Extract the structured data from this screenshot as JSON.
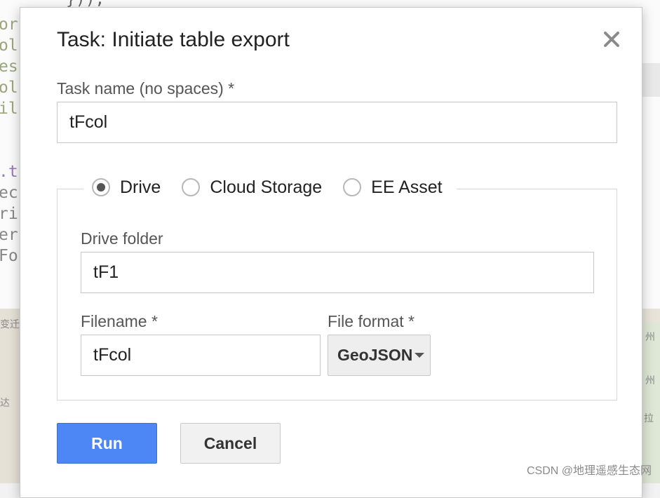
{
  "background": {
    "code_top": "}));",
    "code_lines": [
      "or",
      "ol",
      "es",
      "ol",
      "il",
      "",
      "",
      ".t",
      "ec",
      "ri",
      "er",
      "Fo"
    ],
    "map_labels": [
      "变迁",
      "达",
      "州",
      "州",
      "拉"
    ]
  },
  "dialog": {
    "title": "Task: Initiate table export",
    "close_icon": "close-icon",
    "task_name": {
      "label": "Task name (no spaces) *",
      "value": "tFcol"
    },
    "destinations": [
      {
        "label": "Drive",
        "checked": true
      },
      {
        "label": "Cloud Storage",
        "checked": false
      },
      {
        "label": "EE Asset",
        "checked": false
      }
    ],
    "drive_folder": {
      "label": "Drive folder",
      "value": "tF1"
    },
    "filename": {
      "label": "Filename *",
      "value": "tFcol"
    },
    "file_format": {
      "label": "File format *",
      "selected": "GeoJSON"
    },
    "buttons": {
      "run": "Run",
      "cancel": "Cancel"
    }
  },
  "watermark": "CSDN @地理遥感生态网",
  "colors": {
    "run_button": "#4d87f5",
    "radio_checked": "#555555",
    "border": "#c7c7c7"
  }
}
